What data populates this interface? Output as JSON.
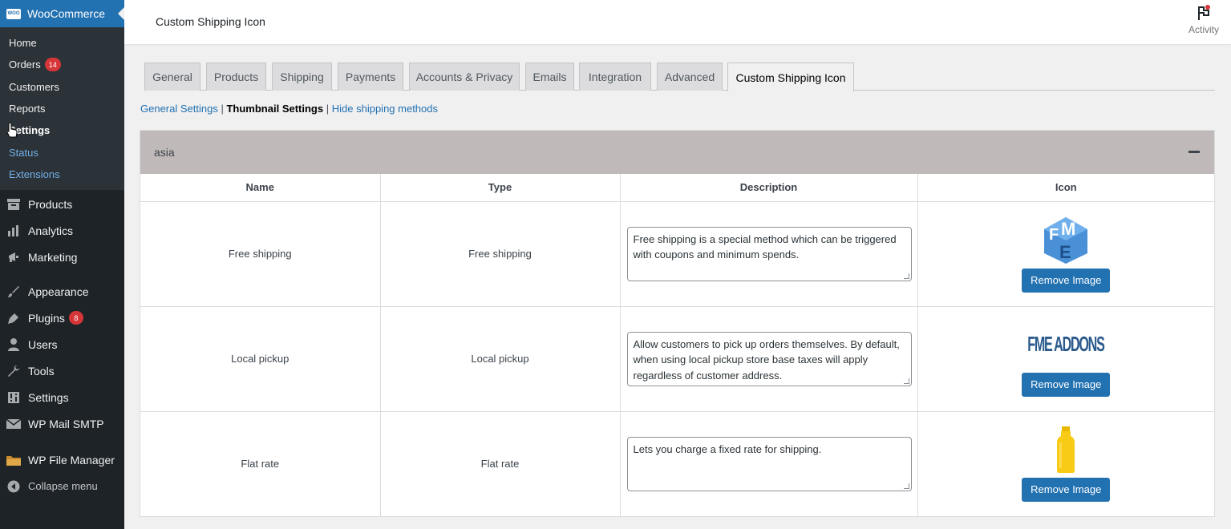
{
  "sidebar": {
    "brand": "WooCommerce",
    "submenu": [
      {
        "label": "Home"
      },
      {
        "label": "Orders",
        "badge": "14"
      },
      {
        "label": "Customers"
      },
      {
        "label": "Reports"
      },
      {
        "label": "Settings"
      },
      {
        "label": "Status"
      },
      {
        "label": "Extensions"
      }
    ],
    "menu": [
      {
        "label": "Products",
        "icon": "archive-icon"
      },
      {
        "label": "Analytics",
        "icon": "bar-chart-icon"
      },
      {
        "label": "Marketing",
        "icon": "megaphone-icon"
      },
      {
        "label": "Appearance",
        "icon": "paintbrush-icon"
      },
      {
        "label": "Plugins",
        "icon": "plugin-icon",
        "badge": "8"
      },
      {
        "label": "Users",
        "icon": "user-icon"
      },
      {
        "label": "Tools",
        "icon": "wrench-icon"
      },
      {
        "label": "Settings",
        "icon": "sliders-icon"
      },
      {
        "label": "WP Mail SMTP",
        "icon": "mail-icon"
      },
      {
        "label": "WP File Manager",
        "icon": "folder-icon"
      },
      {
        "label": "Collapse menu",
        "icon": "collapse-icon"
      }
    ]
  },
  "header": {
    "title": "Custom Shipping Icon",
    "activity_label": "Activity"
  },
  "tabs": [
    {
      "label": "General"
    },
    {
      "label": "Products"
    },
    {
      "label": "Shipping"
    },
    {
      "label": "Payments"
    },
    {
      "label": "Accounts & Privacy"
    },
    {
      "label": "Emails"
    },
    {
      "label": "Integration"
    },
    {
      "label": "Advanced"
    },
    {
      "label": "Custom Shipping Icon",
      "active": true
    }
  ],
  "subnav": {
    "general": "General Settings",
    "thumbnail": "Thumbnail Settings",
    "hide": "Hide shipping methods",
    "sep": "|"
  },
  "zone": {
    "name": "asia",
    "columns": {
      "name": "Name",
      "type": "Type",
      "description": "Description",
      "icon": "Icon"
    },
    "rows": [
      {
        "name": "Free shipping",
        "type": "Free shipping",
        "description": "Free shipping is a special method which can be triggered with coupons and minimum spends.",
        "icon": "fme-logo-icon",
        "button": "Remove Image"
      },
      {
        "name": "Local pickup",
        "type": "Local pickup",
        "description": "Allow customers to pick up orders themselves. By default, when using local pickup store base taxes will apply regardless of customer address.",
        "icon": "fme-addons-wordmark-icon",
        "logo_text": "FME ADDONS",
        "button": "Remove Image"
      },
      {
        "name": "Flat rate",
        "type": "Flat rate",
        "description": "Lets you charge a fixed rate for shipping.",
        "icon": "yellow-bottle-icon",
        "button": "Remove Image"
      }
    ]
  },
  "colors": {
    "admin_blue": "#2271b1",
    "sidebar_bg": "#1d2327",
    "zone_header": "#c0b9b9",
    "badge_red": "#d63638"
  }
}
